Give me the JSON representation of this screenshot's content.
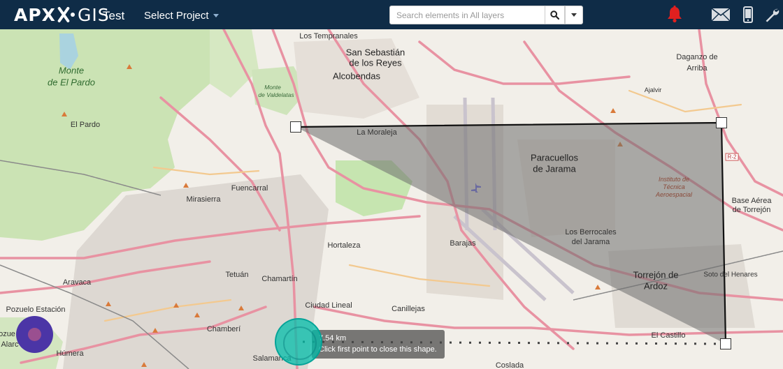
{
  "header": {
    "logo_text_bold": "APX",
    "logo_text_light": "GIS",
    "project_name": "Test",
    "select_project_label": "Select Project"
  },
  "search": {
    "placeholder": "Search elements in All layers",
    "search_icon": "search-icon",
    "dropdown_icon": "caret-down-icon"
  },
  "top_icons": [
    "bell-icon",
    "envelope-icon",
    "mobile-phone-icon",
    "wrench-icon"
  ],
  "colors": {
    "topbar": "#0f2c47",
    "bell": "#e0201f",
    "polygon_fill": "#6e6e6e",
    "cursor_circle": "#00beaa",
    "location_dot": "#4b35a6"
  },
  "map": {
    "places": {
      "los_tempranales": "Los Tempranales",
      "san_sebastian_1": "San Sebastián",
      "san_sebastian_2": "de los Reyes",
      "alcobendas": "Alcobendas",
      "monte_pardo_1": "Monte",
      "monte_pardo_2": "de El Pardo",
      "monte_valdelatas_1": "Monte",
      "monte_valdelatas_2": "de Valdelatas",
      "el_pardo": "El Pardo",
      "la_moraleja": "La Moraleja",
      "paracuellos_1": "Paracuellos",
      "paracuellos_2": "de Jarama",
      "daganzo_1": "Daganzo de",
      "daganzo_2": "Arriba",
      "ajalvir": "Ajalvir",
      "fuencarral": "Fuencarral",
      "mirasierra": "Mirasierra",
      "instituto_1": "Instituto de",
      "instituto_2": "Técnica",
      "instituto_3": "Aeroespacial",
      "base_aerea_1": "Base Aérea",
      "base_aerea_2": "de Torrejón",
      "hortaleza": "Hortaleza",
      "barajas": "Barajas",
      "berrocales_1": "Los Berrocales",
      "berrocales_2": "del Jarama",
      "aravaca": "Aravaca",
      "tetuan": "Tetuán",
      "chamartin": "Chamartín",
      "torrejon_1": "Torrejón de",
      "torrejon_2": "Ardoz",
      "soto_henares": "Soto del Henares",
      "pozuelo_estacion": "Pozuelo Estación",
      "ciudad_lineal": "Ciudad Lineal",
      "canillejas": "Canillejas",
      "chamberi": "Chamberí",
      "salamanca": "Salamanca",
      "el_castillo": "El Castillo",
      "humera": "Húmera",
      "goslada": "Coslada",
      "pozue": "ozue",
      "alarc": "Alarc"
    },
    "roads": [
      "R-2"
    ],
    "measure_tooltip": {
      "distance": "7.54 km",
      "hint": "Click first point to close this shape."
    }
  }
}
